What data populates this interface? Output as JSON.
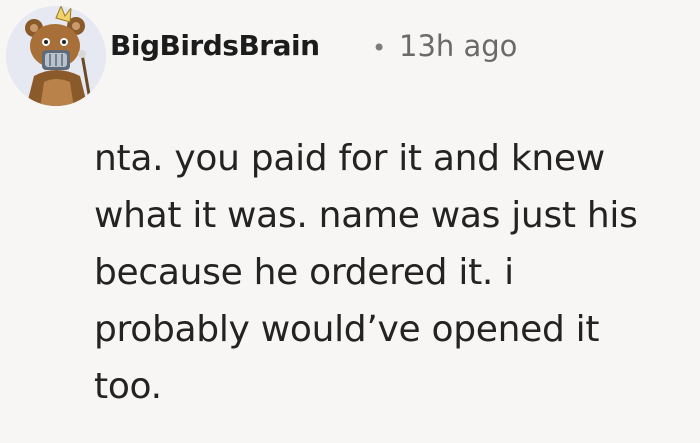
{
  "comment": {
    "author": "BigBirdsBrain",
    "separator": "•",
    "time": "13h ago",
    "avatar_icon": "bear-knight-avatar-icon",
    "text_lines": [
      "nta. you paid for it and knew",
      "what it was. name was just his",
      "because he ordered it. i",
      "probably would’ve opened it",
      "too."
    ]
  },
  "colors": {
    "background": "#f7f6f4",
    "text": "#232323",
    "meta": "#6a6a6a"
  }
}
